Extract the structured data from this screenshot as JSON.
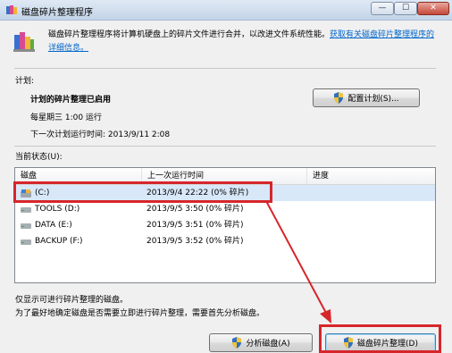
{
  "window": {
    "title": "磁盘碎片整理程序",
    "buttons": {
      "minimize": "—",
      "maximize": "☐",
      "close": "✕"
    }
  },
  "header": {
    "description": "磁盘碎片整理程序将计算机硬盘上的碎片文件进行合并，以改进文件系统性能。",
    "link": "获取有关磁盘碎片整理程序的详细信息。"
  },
  "schedule": {
    "section_label": "计划:",
    "status": "计划的碎片整理已启用",
    "frequency": "每星期三 1:00 运行",
    "next_run": "下一次计划运行时间: 2013/9/11 2:08",
    "configure_button": "配置计划(S)..."
  },
  "current_status": {
    "section_label": "当前状态(U):",
    "columns": [
      "磁盘",
      "上一次运行时间",
      "进度"
    ],
    "disks": [
      {
        "name": "(C:)",
        "last_run": "2013/9/4 22:22 (0% 碎片)",
        "progress": ""
      },
      {
        "name": "TOOLS (D:)",
        "last_run": "2013/9/5 3:50 (0% 碎片)",
        "progress": ""
      },
      {
        "name": "DATA (E:)",
        "last_run": "2013/9/5 3:51 (0% 碎片)",
        "progress": ""
      },
      {
        "name": "BACKUP (F:)",
        "last_run": "2013/9/5 3:52 (0% 碎片)",
        "progress": ""
      }
    ]
  },
  "footer": {
    "note1": "仅显示可进行碎片整理的磁盘。",
    "note2": "为了最好地确定磁盘是否需要立即进行碎片整理，需要首先分析磁盘。",
    "analyze_button": "分析磁盘(A)",
    "defrag_button": "磁盘碎片整理(D)"
  },
  "colors": {
    "annotation": "#d6262b",
    "link": "#0066cc",
    "selection": "#d9e8f9"
  }
}
